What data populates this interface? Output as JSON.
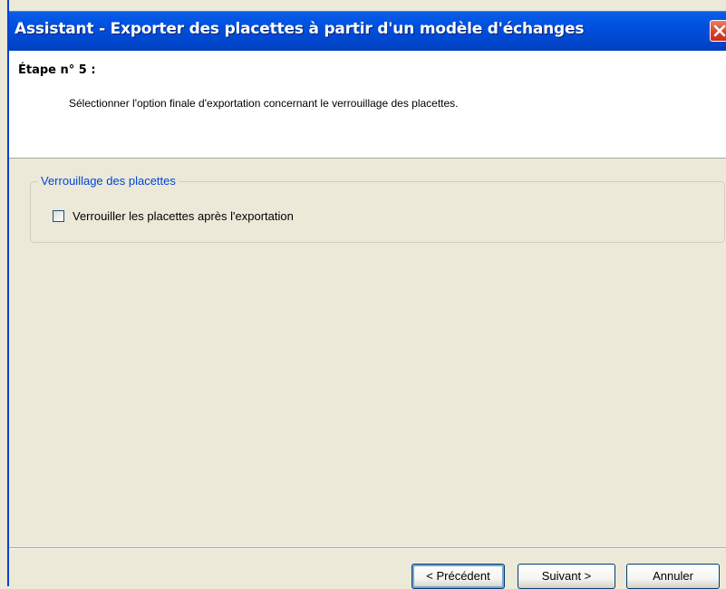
{
  "window": {
    "title": "Assistant - Exporter des placettes à partir d'un modèle d'échanges",
    "close_icon": "close-icon"
  },
  "header": {
    "step_title": "Étape n° 5 :",
    "step_description": "Sélectionner l'option finale d'exportation concernant le verrouillage des placettes."
  },
  "group": {
    "legend": "Verrouillage des placettes",
    "checkbox_label": "Verrouiller les placettes après l'exportation",
    "checked": false
  },
  "buttons": {
    "previous": "< Précédent",
    "next": "Suivant >",
    "cancel": "Annuler"
  },
  "colors": {
    "titlebar": "#0054e3",
    "close_button": "#d4402a",
    "group_legend": "#0046d5",
    "dialog_bg": "#ece9d8"
  }
}
